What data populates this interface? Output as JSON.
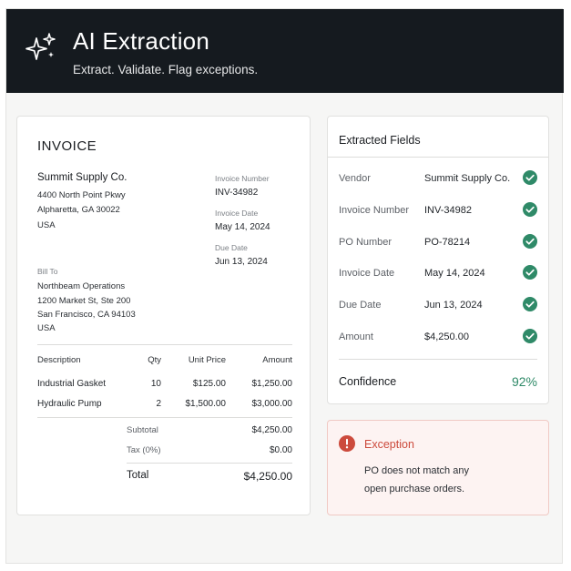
{
  "header": {
    "title": "AI Extraction",
    "subtitle": "Extract. Validate. Flag exceptions.",
    "icon": "sparkles-icon"
  },
  "invoice": {
    "heading": "INVOICE",
    "vendor": {
      "name": "Summit Supply Co.",
      "address1": "4400 North Point Pkwy",
      "address2": "Alpharetta, GA 30022",
      "country": "USA"
    },
    "meta": {
      "number_label": "Invoice Number",
      "number": "INV-34982",
      "date_label": "Invoice Date",
      "date": "May 14, 2024",
      "due_label": "Due Date",
      "due": "Jun 13, 2024"
    },
    "bill_to": {
      "label": "Bill To",
      "name": "Northbeam Operations",
      "address1": "1200 Market St, Ste 200",
      "address2": "San Francisco, CA 94103",
      "country": "USA"
    },
    "columns": [
      "Description",
      "Qty",
      "Unit Price",
      "Amount"
    ],
    "lines": [
      {
        "description": "Industrial Gasket",
        "qty": "10",
        "unit_price": "$125.00",
        "amount": "$1,250.00"
      },
      {
        "description": "Hydraulic Pump",
        "qty": "2",
        "unit_price": "$1,500.00",
        "amount": "$3,000.00"
      }
    ],
    "subtotal_label": "Subtotal",
    "subtotal": "$4,250.00",
    "tax_label": "Tax (0%)",
    "tax": "$0.00",
    "total_label": "Total",
    "total": "$4,250.00"
  },
  "extracted": {
    "title": "Extracted Fields",
    "fields": [
      {
        "label": "Vendor",
        "value": "Summit Supply Co.",
        "status": "valid"
      },
      {
        "label": "Invoice Number",
        "value": "INV-34982",
        "status": "valid"
      },
      {
        "label": "PO Number",
        "value": "PO-78214",
        "status": "valid"
      },
      {
        "label": "Invoice Date",
        "value": "May 14, 2024",
        "status": "valid"
      },
      {
        "label": "Due Date",
        "value": "Jun 13, 2024",
        "status": "valid"
      },
      {
        "label": "Amount",
        "value": "$4,250.00",
        "status": "valid"
      }
    ],
    "confidence_label": "Confidence",
    "confidence": "92%",
    "check_color": "#2f8a68"
  },
  "exception": {
    "title": "Exception",
    "message_line1": "PO does not match any",
    "message_line2": "open purchase orders.",
    "color": "#cc4a3c"
  }
}
